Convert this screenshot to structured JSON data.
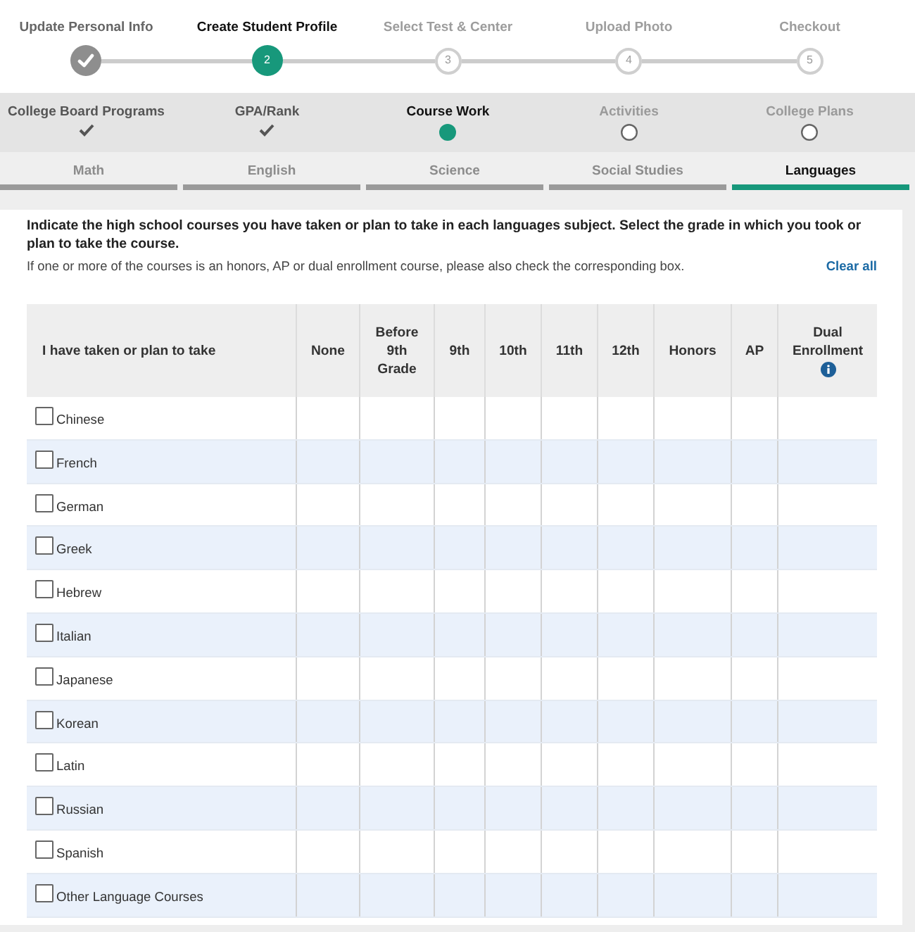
{
  "progress_steps": [
    {
      "label": "Update Personal Info",
      "done": true,
      "current": false
    },
    {
      "label": "Create Student Profile",
      "number": "2",
      "done": false,
      "current": true
    },
    {
      "label": "Select Test & Center",
      "number": "3",
      "done": false,
      "current": false
    },
    {
      "label": "Upload Photo",
      "number": "4",
      "done": false,
      "current": false
    },
    {
      "label": "Checkout",
      "number": "5",
      "done": false,
      "current": false
    }
  ],
  "profile_sections": [
    {
      "label": "College Board Programs",
      "done": true,
      "current": false
    },
    {
      "label": "GPA/Rank",
      "done": true,
      "current": false
    },
    {
      "label": "Course Work",
      "done": false,
      "current": true
    },
    {
      "label": "Activities",
      "done": false,
      "current": false
    },
    {
      "label": "College Plans",
      "done": false,
      "current": false
    }
  ],
  "subject_tabs": [
    {
      "label": "Math",
      "selected": false
    },
    {
      "label": "English",
      "selected": false
    },
    {
      "label": "Science",
      "selected": false
    },
    {
      "label": "Social Studies",
      "selected": false
    },
    {
      "label": "Languages",
      "selected": true
    }
  ],
  "instructions": {
    "prompt": "Indicate the high school courses you have taken or plan to take in each languages subject. Select the grade in which you took or plan to take the course.",
    "note": "If one or more of the courses is an honors, AP or dual enrollment course, please also check the corresponding box.",
    "clear_link": "Clear all"
  },
  "course_table": {
    "columns": [
      {
        "label": "I have taken or plan to take",
        "info": false
      },
      {
        "label": "None",
        "info": false
      },
      {
        "label": "Before 9th Grade",
        "info": false
      },
      {
        "label": "9th",
        "info": false
      },
      {
        "label": "10th",
        "info": false
      },
      {
        "label": "11th",
        "info": false
      },
      {
        "label": "12th",
        "info": false
      },
      {
        "label": "Honors",
        "info": false
      },
      {
        "label": "AP",
        "info": false
      },
      {
        "label": "Dual Enrollment",
        "info": true
      }
    ],
    "rows": [
      {
        "course": "Chinese",
        "checked": false
      },
      {
        "course": "French",
        "checked": false
      },
      {
        "course": "German",
        "checked": false
      },
      {
        "course": "Greek",
        "checked": false
      },
      {
        "course": "Hebrew",
        "checked": false
      },
      {
        "course": "Italian",
        "checked": false
      },
      {
        "course": "Japanese",
        "checked": false
      },
      {
        "course": "Korean",
        "checked": false
      },
      {
        "course": "Latin",
        "checked": false
      },
      {
        "course": "Russian",
        "checked": false
      },
      {
        "course": "Spanish",
        "checked": false
      },
      {
        "course": "Other Language Courses",
        "checked": false
      }
    ]
  }
}
